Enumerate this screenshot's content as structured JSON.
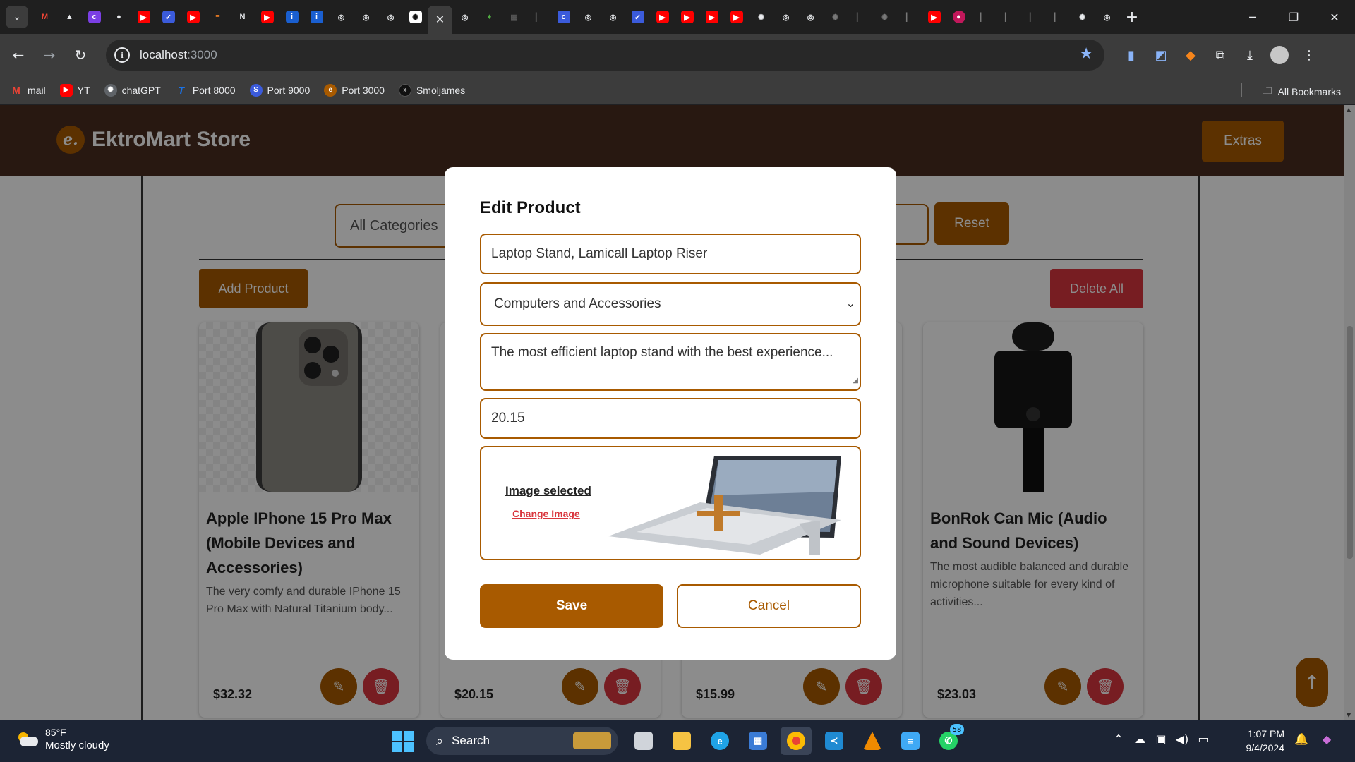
{
  "browser": {
    "address": {
      "host": "localhost",
      "port": ":3000"
    },
    "bookmarks": [
      {
        "label": "mail",
        "icon": "gmail-icon",
        "color": "#ea4335",
        "glyph": "M"
      },
      {
        "label": "YT",
        "icon": "youtube-icon",
        "color": "#ff0000",
        "glyph": "▶"
      },
      {
        "label": "chatGPT",
        "icon": "openai-icon",
        "color": "#5f6368",
        "glyph": "✺"
      },
      {
        "label": "Port 8000",
        "icon": "port-icon",
        "color": "#1a73e8",
        "glyph": "T"
      },
      {
        "label": "Port 9000",
        "icon": "port-icon",
        "color": "#3b5bdb",
        "glyph": "S"
      },
      {
        "label": "Port 3000",
        "icon": "ektromart-icon",
        "color": "#a85a00",
        "glyph": "e"
      },
      {
        "label": "Smoljames",
        "icon": "chevrons-icon",
        "color": "#111111",
        "glyph": "»"
      }
    ],
    "all_bookmarks": "All Bookmarks"
  },
  "site": {
    "brand": "EktroMart Store",
    "logo_glyph": "e.",
    "extras_label": "Extras",
    "filter": {
      "category": "All Categories",
      "reset_label": "Reset"
    },
    "add_product_label": "Add Product",
    "delete_all_label": "Delete All",
    "products": [
      {
        "title": "Apple IPhone 15 Pro Max (Mobile Devices and Accessories)",
        "description": "The very comfy and durable IPhone 15 Pro Max with Natural Titanium body...",
        "price": "$32.32"
      },
      {
        "title": "",
        "description": "",
        "price": "$20.15"
      },
      {
        "title": "",
        "description": "",
        "price": "$15.99"
      },
      {
        "title": "BonRok Can Mic (Audio and Sound Devices)",
        "description": "The most audible balanced and durable microphone suitable for every kind of activities...",
        "price": "$23.03"
      }
    ]
  },
  "modal": {
    "title": "Edit Product",
    "name_value": "Laptop Stand, Lamicall Laptop Riser",
    "category_value": "Computers and Accessories",
    "description_value": "The most efficient laptop stand with the best experience...",
    "price_value": "20.15",
    "image_status": "Image selected",
    "change_image_label": "Change Image",
    "save_label": "Save",
    "cancel_label": "Cancel"
  },
  "taskbar": {
    "weather_temp": "85°F",
    "weather_condition": "Mostly cloudy",
    "search_label": "Search",
    "time": "1:07 PM",
    "date": "9/4/2024",
    "whatsapp_badge": "58"
  },
  "colors": {
    "accent": "#a85a00",
    "danger": "#d9363e",
    "header": "#4a2c20"
  }
}
